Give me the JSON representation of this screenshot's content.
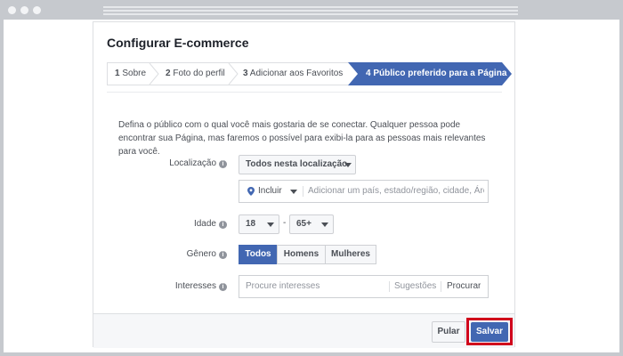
{
  "dialog": {
    "title": "Configurar E-commerce"
  },
  "steps": [
    {
      "num": "1",
      "label": "Sobre"
    },
    {
      "num": "2",
      "label": "Foto do perfil"
    },
    {
      "num": "3",
      "label": "Adicionar aos Favoritos"
    },
    {
      "num": "4",
      "label": "Público preferido para a Página"
    }
  ],
  "description": "Defina o público com o qual você mais gostaria de se conectar. Qualquer pessoa pode encontrar sua Página, mas faremos o possível para exibi-la para as pessoas mais relevantes para você.",
  "location": {
    "label": "Localização",
    "dropdown_value": "Todos nesta localização",
    "include_label": "Incluir",
    "placeholder": "Adicionar um país, estado/região, cidade, Área"
  },
  "age": {
    "label": "Idade",
    "min": "18",
    "max": "65+",
    "separator": "-"
  },
  "gender": {
    "label": "Gênero",
    "options": [
      "Todos",
      "Homens",
      "Mulheres"
    ],
    "selected": "Todos"
  },
  "interests": {
    "label": "Interesses",
    "placeholder": "Procure interesses",
    "suggestions_label": "Sugestões",
    "search_label": "Procurar"
  },
  "footer": {
    "skip_label": "Pular",
    "save_label": "Salvar"
  },
  "colors": {
    "accent": "#4267b2",
    "highlight": "#d0021b"
  }
}
